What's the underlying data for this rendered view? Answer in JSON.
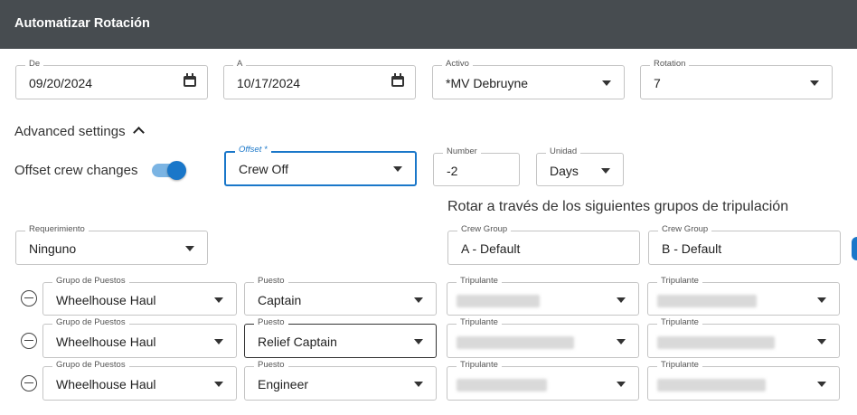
{
  "title": "Automatizar Rotación",
  "top": {
    "de_label": "De",
    "de_value": "09/20/2024",
    "a_label": "A",
    "a_value": "10/17/2024",
    "activo_label": "Activo",
    "activo_value": "*MV Debruyne",
    "rotation_label": "Rotation",
    "rotation_value": "7"
  },
  "advanced": {
    "title": "Advanced settings",
    "offset_toggle_label": "Offset crew changes",
    "offset_toggle_on": true,
    "offset_label": "Offset *",
    "offset_value": "Crew Off",
    "number_label": "Number",
    "number_value": "-2",
    "unidad_label": "Unidad",
    "unidad_value": "Days"
  },
  "rotate_heading": "Rotar a través de los siguientes grupos de tripulación",
  "requerimiento": {
    "label": "Requerimiento",
    "value": "Ninguno"
  },
  "crew_groups": [
    {
      "label": "Crew Group",
      "value": "A - Default"
    },
    {
      "label": "Crew Group",
      "value": "B - Default"
    }
  ],
  "rows": [
    {
      "grupo_label": "Grupo de Puestos",
      "grupo_value": "Wheelhouse Haul",
      "puesto_label": "Puesto",
      "puesto_value": "Captain",
      "trip_label_a": "Tripulante",
      "trip_label_b": "Tripulante"
    },
    {
      "grupo_label": "Grupo de Puestos",
      "grupo_value": "Wheelhouse Haul",
      "puesto_label": "Puesto",
      "puesto_value": "Relief Captain",
      "trip_label_a": "Tripulante",
      "trip_label_b": "Tripulante"
    },
    {
      "grupo_label": "Grupo de Puestos",
      "grupo_value": "Wheelhouse Haul",
      "puesto_label": "Puesto",
      "puesto_value": "Engineer",
      "trip_label_a": "Tripulante",
      "trip_label_b": "Tripulante"
    }
  ],
  "icons": {
    "calendar": "calendar-icon",
    "dropdown": "chevron-down-icon",
    "remove": "minus-circle-icon",
    "collapse": "chevron-up-icon"
  },
  "colors": {
    "header_bg": "#474c50",
    "accent": "#1a77c9"
  }
}
